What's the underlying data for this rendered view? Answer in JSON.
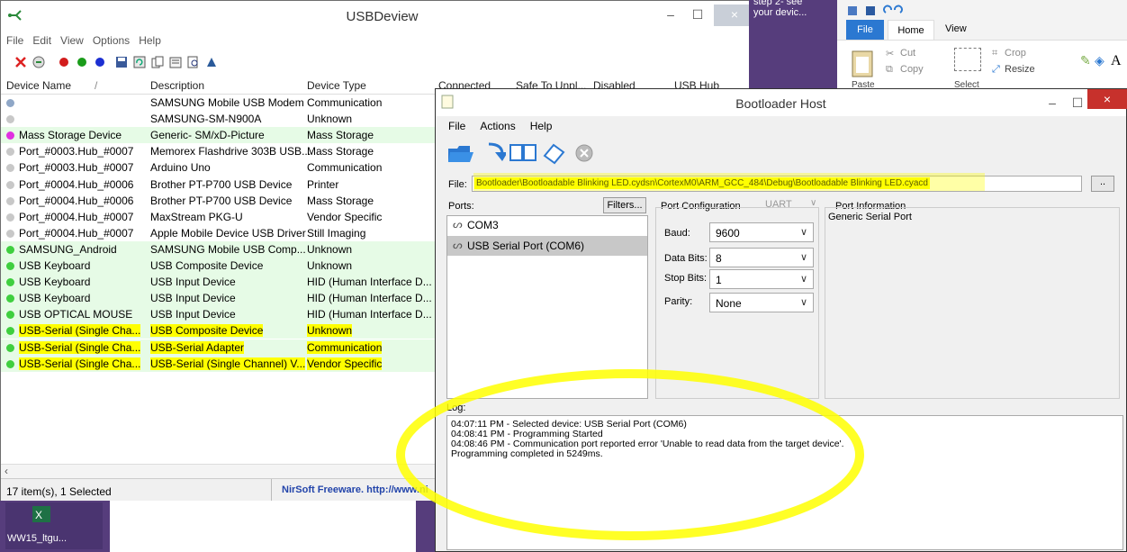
{
  "usbdeview": {
    "title": "USBDeview",
    "menu": [
      "File",
      "Edit",
      "View",
      "Options",
      "Help"
    ],
    "columns": [
      "Device Name",
      "/",
      "Description",
      "Device Type",
      "Connected",
      "Safe To Unpl...",
      "Disabled",
      "USB Hub"
    ],
    "rows": [
      {
        "name": "",
        "desc": "SAMSUNG Mobile USB Modem",
        "type": "Communication",
        "dot": "#8fa7c7",
        "green": false
      },
      {
        "name": "",
        "desc": "SAMSUNG-SM-N900A",
        "type": "Unknown",
        "dot": "#c8c8c8",
        "green": false
      },
      {
        "name": "Mass Storage Device",
        "desc": "Generic- SM/xD-Picture",
        "type": "Mass Storage",
        "dot": "#e02fe0",
        "green": true
      },
      {
        "name": "Port_#0003.Hub_#0007",
        "desc": "Memorex Flashdrive 303B USB...",
        "type": "Mass Storage",
        "dot": "#c8c8c8",
        "green": false
      },
      {
        "name": "Port_#0003.Hub_#0007",
        "desc": "Arduino Uno",
        "type": "Communication",
        "dot": "#c8c8c8",
        "green": false
      },
      {
        "name": "Port_#0004.Hub_#0006",
        "desc": "Brother PT-P700 USB Device",
        "type": "Printer",
        "dot": "#c8c8c8",
        "green": false
      },
      {
        "name": "Port_#0004.Hub_#0006",
        "desc": "Brother PT-P700 USB Device",
        "type": "Mass Storage",
        "dot": "#c8c8c8",
        "green": false
      },
      {
        "name": "Port_#0004.Hub_#0007",
        "desc": "MaxStream PKG-U",
        "type": "Vendor Specific",
        "dot": "#c8c8c8",
        "green": false
      },
      {
        "name": "Port_#0004.Hub_#0007",
        "desc": "Apple Mobile Device USB Driver",
        "type": "Still Imaging",
        "dot": "#c8c8c8",
        "green": false
      },
      {
        "name": "SAMSUNG_Android",
        "desc": "SAMSUNG Mobile USB Comp...",
        "type": "Unknown",
        "dot": "#3fcf3f",
        "green": true
      },
      {
        "name": "USB Keyboard",
        "desc": "USB Composite Device",
        "type": "Unknown",
        "dot": "#3fcf3f",
        "green": true
      },
      {
        "name": "USB Keyboard",
        "desc": "USB Input Device",
        "type": "HID (Human Interface D...",
        "dot": "#3fcf3f",
        "green": true
      },
      {
        "name": "USB Keyboard",
        "desc": "USB Input Device",
        "type": "HID (Human Interface D...",
        "dot": "#3fcf3f",
        "green": true
      },
      {
        "name": "USB OPTICAL MOUSE",
        "desc": "USB Input Device",
        "type": "HID (Human Interface D...",
        "dot": "#3fcf3f",
        "green": true
      },
      {
        "name": "USB-Serial (Single Cha...",
        "desc": "USB Composite Device",
        "type": "Unknown",
        "dot": "#3fcf3f",
        "green": true,
        "hl": true
      },
      {
        "name": "USB-Serial (Single Cha...",
        "desc": "USB-Serial Adapter",
        "type": "Communication",
        "dot": "#3fcf3f",
        "green": true,
        "hl": true
      },
      {
        "name": "USB-Serial (Single Cha...",
        "desc": "USB-Serial (Single Channel) V...",
        "type": "Vendor Specific",
        "dot": "#3fcf3f",
        "green": true,
        "hl": true
      }
    ],
    "status_count": "17 item(s), 1 Selected",
    "status_link": "NirSoft Freeware.  http://www.ni"
  },
  "taskbar_tile": {
    "label": "WW15_ltgu..."
  },
  "behind_window": {
    "line1": "step 2- see",
    "line2": "your devic..."
  },
  "ribbon": {
    "tabs": [
      "File",
      "Home",
      "View"
    ],
    "cut": "Cut",
    "copy": "Copy",
    "paste": "Paste",
    "select": "Select",
    "crop": "Crop",
    "resize": "Resize",
    "text": "A"
  },
  "bootloader": {
    "title": "Bootloader Host",
    "menu": [
      "File",
      "Actions",
      "Help"
    ],
    "file_label": "File:",
    "file_path": "Bootloader\\Bootloadable Blinking LED.cydsn\\CortexM0\\ARM_GCC_484\\Debug\\Bootloadable Blinking LED.cyacd",
    "browse": "..",
    "ports_label": "Ports:",
    "filters": "Filters...",
    "ports": [
      "COM3",
      "USB Serial Port (COM6)"
    ],
    "port_config_label": "Port Configuration",
    "port_type": "UART",
    "baud_label": "Baud:",
    "baud": "9600",
    "databits_label": "Data Bits:",
    "databits": "8",
    "stopbits_label": "Stop Bits:",
    "stopbits": "1",
    "parity_label": "Parity:",
    "parity": "None",
    "port_info_label": "Port Information",
    "port_info": "Generic Serial Port",
    "log_label": "Log:",
    "log": [
      "04:07:11 PM - Selected device: USB Serial Port (COM6)",
      "04:08:41 PM - Programming Started",
      "04:08:46 PM - Communication port reported error 'Unable to read data from the target device'.",
      "Programming completed in 5249ms."
    ]
  },
  "colors": {
    "highlight": "#ffff00",
    "desktop": "#563d7c",
    "accent_blue": "#2b78d1",
    "close_red": "#c7312c"
  }
}
